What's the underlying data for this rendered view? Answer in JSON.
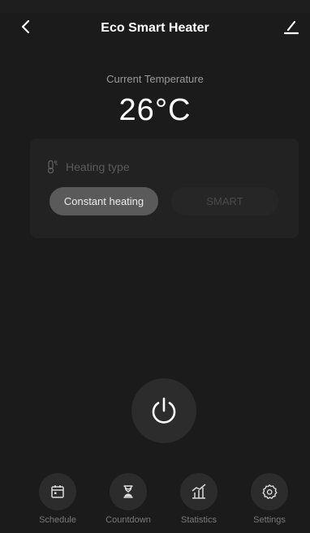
{
  "header": {
    "title": "Eco Smart Heater",
    "back_icon": "chevron-left-icon",
    "edit_icon": "edit-icon"
  },
  "current": {
    "label": "Current Temperature",
    "value": "26°C"
  },
  "heating": {
    "icon": "thermometer-icon",
    "label": "Heating type",
    "options": [
      {
        "label": "Constant heating",
        "selected": true
      },
      {
        "label": "SMART",
        "selected": false
      }
    ]
  },
  "power": {
    "icon": "power-icon"
  },
  "tabs": [
    {
      "label": "Schedule",
      "icon": "calendar-icon"
    },
    {
      "label": "Countdown",
      "icon": "hourglass-icon"
    },
    {
      "label": "Statistics",
      "icon": "chart-icon"
    },
    {
      "label": "Settings",
      "icon": "gear-icon"
    }
  ],
  "colors": {
    "background": "#1b1b1b",
    "card": "#222222",
    "selected": "#5a5a5a",
    "text_secondary": "#9a9a9a"
  }
}
